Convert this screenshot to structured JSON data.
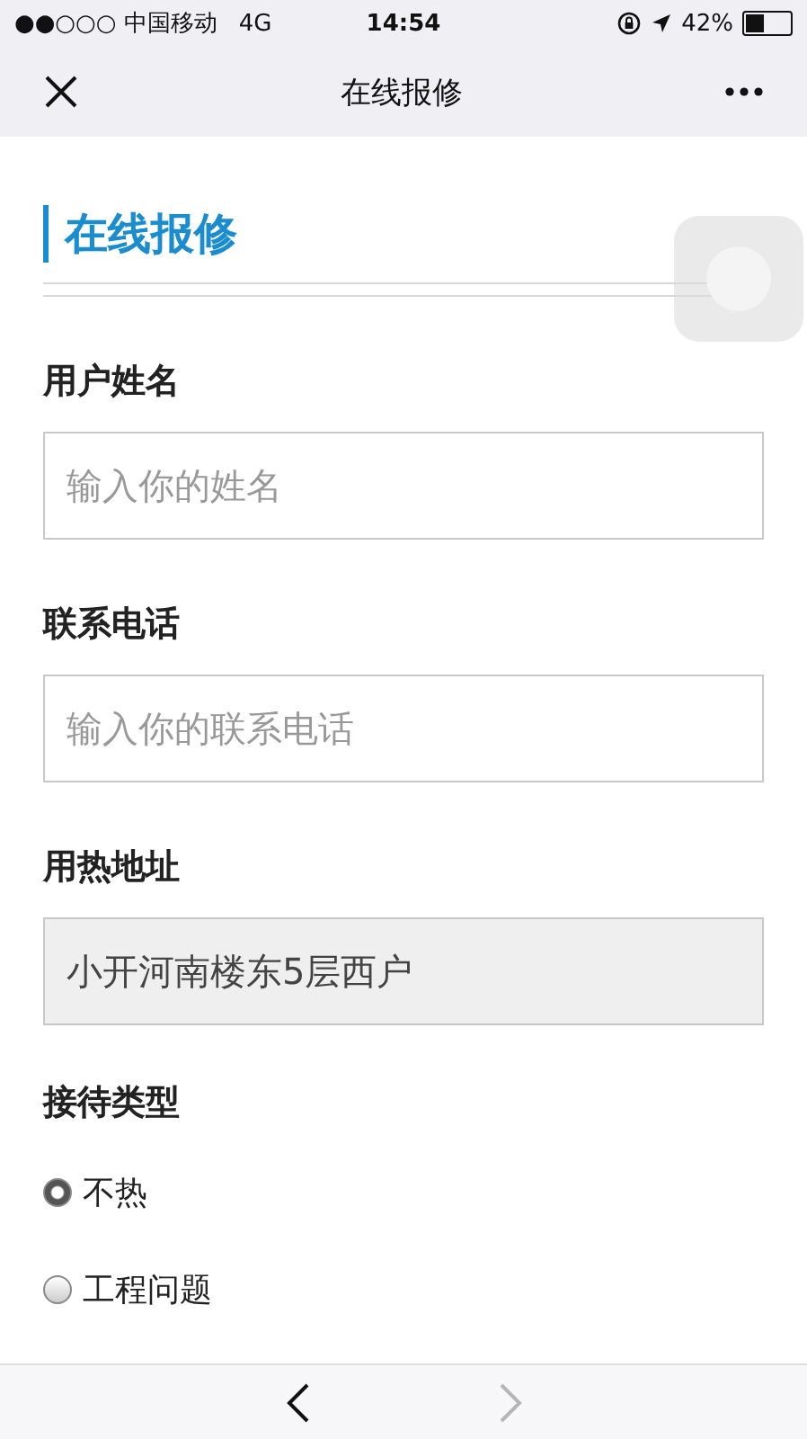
{
  "status_bar": {
    "carrier": "●●○○○ 中国移动",
    "network": "4G",
    "time": "14:54",
    "battery": "42%"
  },
  "nav_bar": {
    "title": "在线报修"
  },
  "section_title": "在线报修",
  "fields": [
    {
      "label": "用户姓名",
      "placeholder": "输入你的姓名",
      "disabled": false
    },
    {
      "label": "联系电话",
      "placeholder": "输入你的联系电话",
      "disabled": false
    },
    {
      "label": "用热地址",
      "value": "小开河南楼东5层西户",
      "disabled": true
    }
  ],
  "reception_type": {
    "label": "接待类型",
    "options": [
      {
        "label": "不热",
        "selected": true
      },
      {
        "label": "工程问题",
        "selected": false
      }
    ]
  },
  "toolbar": [
    {
      "kind": "back",
      "disabled": false
    },
    {
      "kind": "forward",
      "disabled": true
    }
  ]
}
